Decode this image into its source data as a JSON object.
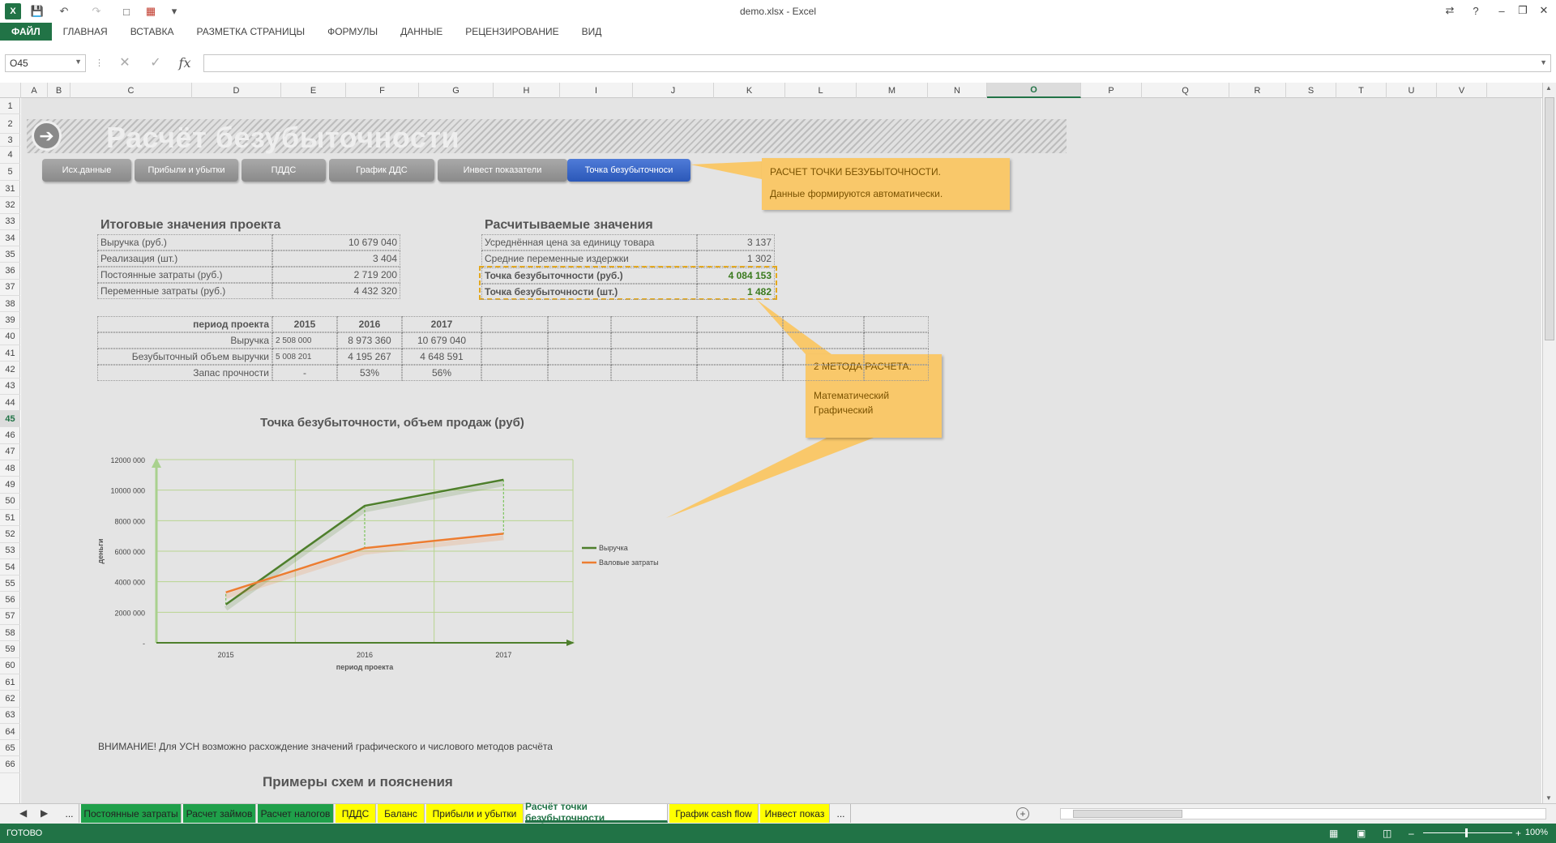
{
  "window": {
    "title": "demo.xlsx - Excel"
  },
  "ribbon_tabs": [
    "ФАЙЛ",
    "ГЛАВНАЯ",
    "ВСТАВКА",
    "РАЗМЕТКА СТРАНИЦЫ",
    "ФОРМУЛЫ",
    "ДАННЫЕ",
    "РЕЦЕНЗИРОВАНИЕ",
    "ВИД"
  ],
  "formula": {
    "name_box": "O45",
    "fx_label": "fx",
    "content": ""
  },
  "columns": [
    "A",
    "B",
    "C",
    "D",
    "E",
    "F",
    "G",
    "H",
    "I",
    "J",
    "K",
    "L",
    "M",
    "N",
    "O",
    "P",
    "Q",
    "R",
    "S",
    "T",
    "U",
    "V"
  ],
  "selected_column": "O",
  "rows": [
    "1",
    "2",
    "3",
    "4",
    "5",
    "31",
    "32",
    "33",
    "34",
    "35",
    "36",
    "37",
    "38",
    "39",
    "40",
    "41",
    "42",
    "43",
    "44",
    "45",
    "46",
    "47",
    "48",
    "49",
    "50",
    "51",
    "52",
    "53",
    "54",
    "55",
    "56",
    "57",
    "58",
    "59",
    "60",
    "61",
    "62",
    "63",
    "64",
    "65",
    "66"
  ],
  "selected_row": "45",
  "banner": {
    "title": "Расчёт безубыточности"
  },
  "nav_buttons": [
    {
      "label": "Исх.данные",
      "active": false
    },
    {
      "label": "Прибыли и убытки",
      "active": false
    },
    {
      "label": "ПДДС",
      "active": false
    },
    {
      "label": "График ДДС",
      "active": false
    },
    {
      "label": "Инвест показатели",
      "active": false
    },
    {
      "label": "Точка безубыточноси",
      "active": true
    }
  ],
  "callout_top": {
    "line1": "РАСЧЕТ ТОЧКИ БЕЗУБЫТОЧНОСТИ.",
    "line2": "Данные формируются автоматически."
  },
  "callout_methods": {
    "line1": "2 МЕТОДА РАСЧЕТА.",
    "line2": "Математический",
    "line3": "Графический"
  },
  "summary": {
    "title": "Итоговые значения проекта",
    "rows": [
      {
        "label": "Выручка (руб.)",
        "value": "10 679 040"
      },
      {
        "label": "Реализация (шт.)",
        "value": "3 404"
      },
      {
        "label": "Постоянные затраты (руб.)",
        "value": "2 719 200"
      },
      {
        "label": "Переменные затраты (руб.)",
        "value": "4 432 320"
      }
    ]
  },
  "calculated": {
    "title": "Расчитываемые значения",
    "rows": [
      {
        "label": "Усреднённая цена за единицу товара",
        "value": "3 137"
      },
      {
        "label": "Средние переменные издержки",
        "value": "1 302"
      },
      {
        "label": "Точка безубыточности (руб.)",
        "value": "4 084 153"
      },
      {
        "label": "Точка безубыточности (шт.)",
        "value": "1 482"
      }
    ]
  },
  "period_table": {
    "header": [
      "период проекта",
      "2015",
      "2016",
      "2017"
    ],
    "rows": [
      {
        "label": "Выручка",
        "values": [
          "2 508 000",
          "8 973 360",
          "10 679 040"
        ]
      },
      {
        "label": "Безубыточный объем выручки",
        "values": [
          "5 008 201",
          "4 195 267",
          "4 648 591"
        ]
      },
      {
        "label": "Запас прочности",
        "values": [
          "-",
          "53%",
          "56%"
        ]
      }
    ]
  },
  "chart_data": {
    "type": "line",
    "title": "Точка безубыточности, объем продаж (руб)",
    "xlabel": "период проекта",
    "ylabel": "деньги",
    "categories": [
      "2015",
      "2016",
      "2017"
    ],
    "y_ticks": [
      "-",
      "2000 000",
      "4000 000",
      "6000 000",
      "8000 000",
      "10000 000",
      "12000 000"
    ],
    "ylim": [
      0,
      12000000
    ],
    "grid": true,
    "legend_position": "right",
    "series": [
      {
        "name": "Выручка",
        "values": [
          2508000,
          8973360,
          10679040
        ],
        "color": "#4e7f2c"
      },
      {
        "name": "Валовые затраты",
        "values": [
          3300000,
          6200000,
          7150000
        ],
        "color": "#ed7d31"
      }
    ]
  },
  "warning": "ВНИМАНИЕ! Для УСН возможно расхождение значений графического и числового методов расчёта",
  "examples_title": "Примеры схем и пояснения",
  "sheet_tabs": [
    {
      "label": "...",
      "style": "plain"
    },
    {
      "label": "Постоянные затраты",
      "style": "green"
    },
    {
      "label": "Расчет займов",
      "style": "green"
    },
    {
      "label": "Расчет налогов",
      "style": "green"
    },
    {
      "label": "ПДДС",
      "style": "yellow"
    },
    {
      "label": "Баланс",
      "style": "yellow"
    },
    {
      "label": "Прибыли и убытки",
      "style": "yellow"
    },
    {
      "label": "Расчёт точки безубыточности",
      "style": "active"
    },
    {
      "label": "График cash flow",
      "style": "yellow"
    },
    {
      "label": "Инвест показ",
      "style": "yellow"
    },
    {
      "label": "...",
      "style": "plain"
    }
  ],
  "status": {
    "text": "ГОТОВО",
    "zoom": "100%"
  }
}
